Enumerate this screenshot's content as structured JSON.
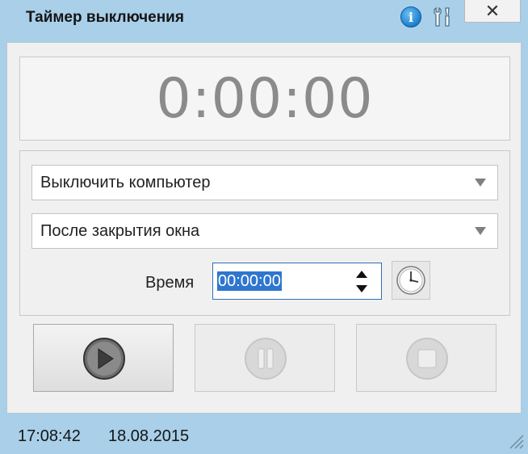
{
  "window": {
    "title": "Таймер выключения",
    "info_icon": "info-icon",
    "tools_icon": "tools-icon",
    "close_icon": "close-icon",
    "info_glyph": "i",
    "close_glyph": "✕"
  },
  "timer": {
    "display": "0:00:00"
  },
  "action_select": {
    "selected": "Выключить компьютер"
  },
  "mode_select": {
    "selected": "После закрытия окна"
  },
  "time_field": {
    "label": "Время",
    "value": "00:00:00"
  },
  "buttons": {
    "play_icon": "play-icon",
    "pause_icon": "pause-icon",
    "stop_icon": "stop-icon"
  },
  "status": {
    "time": "17:08:42",
    "date": "18.08.2015"
  },
  "colors": {
    "frame": "#a9cfe9",
    "content_bg": "#f0f0f0",
    "selection": "#2f76cf",
    "timer_text": "#8b8b8b"
  }
}
